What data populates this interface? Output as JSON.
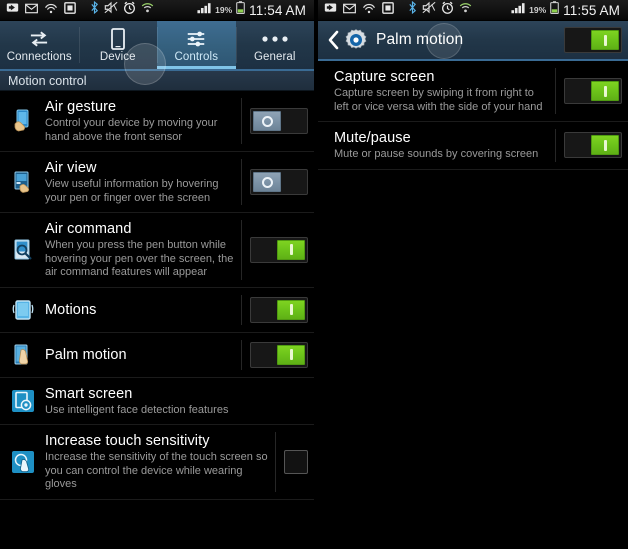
{
  "left_screen": {
    "status_bar": {
      "time": "11:54 AM",
      "battery_percent": "19%",
      "icons": [
        "download-icon",
        "email-icon",
        "wifi-direct-icon",
        "sd-card-icon",
        "bluetooth-icon",
        "sound-off-icon",
        "alarm-icon",
        "wifi-icon",
        "signal-icon"
      ]
    },
    "tabs": [
      {
        "label": "Connections",
        "icon": "connections-arrows-icon",
        "active": false
      },
      {
        "label": "Device",
        "icon": "device-phone-icon",
        "active": false
      },
      {
        "label": "Controls",
        "icon": "controls-sliders-icon",
        "active": true
      },
      {
        "label": "General",
        "icon": "more-dots-icon",
        "active": false
      }
    ],
    "section_header": "Motion control",
    "rows": [
      {
        "title": "Air gesture",
        "subtitle": "Control your device by moving your hand above the front sensor",
        "icon": "air-gesture-icon",
        "control": "switch",
        "state": "off"
      },
      {
        "title": "Air view",
        "subtitle": "View useful information by hovering your pen or finger over the screen",
        "icon": "air-view-icon",
        "control": "switch",
        "state": "off"
      },
      {
        "title": "Air command",
        "subtitle": "When you press the pen button while hovering your pen over the screen, the air command features will appear",
        "icon": "air-command-icon",
        "control": "switch",
        "state": "on"
      },
      {
        "title": "Motions",
        "subtitle": "",
        "icon": "motions-icon",
        "control": "switch",
        "state": "on"
      },
      {
        "title": "Palm motion",
        "subtitle": "",
        "icon": "palm-motion-icon",
        "control": "switch",
        "state": "on"
      },
      {
        "title": "Smart screen",
        "subtitle": "Use intelligent face detection features",
        "icon": "smart-screen-icon",
        "control": "none",
        "state": ""
      },
      {
        "title": "Increase touch sensitivity",
        "subtitle": "Increase the sensitivity of the touch screen so you can control the device while wearing gloves",
        "icon": "touch-sensitivity-icon",
        "control": "checkbox",
        "state": "unchecked"
      }
    ]
  },
  "right_screen": {
    "status_bar": {
      "time": "11:55 AM",
      "battery_percent": "19%"
    },
    "action_bar": {
      "back_icon": "back-chevron-icon",
      "app_icon": "settings-gear-icon",
      "title": "Palm motion",
      "master_switch_state": "on"
    },
    "rows": [
      {
        "title": "Capture screen",
        "subtitle": "Capture screen by swiping it from right to left or vice versa with the side of your hand",
        "control": "switch",
        "state": "on"
      },
      {
        "title": "Mute/pause",
        "subtitle": "Mute or pause sounds by covering screen",
        "control": "switch",
        "state": "on"
      }
    ]
  },
  "colors": {
    "accent_green": "#7ed321",
    "tab_active_blue": "#3f6d92",
    "tab_underline": "#7fc4e8",
    "header_blue": "#27384a",
    "background": "#000000"
  }
}
